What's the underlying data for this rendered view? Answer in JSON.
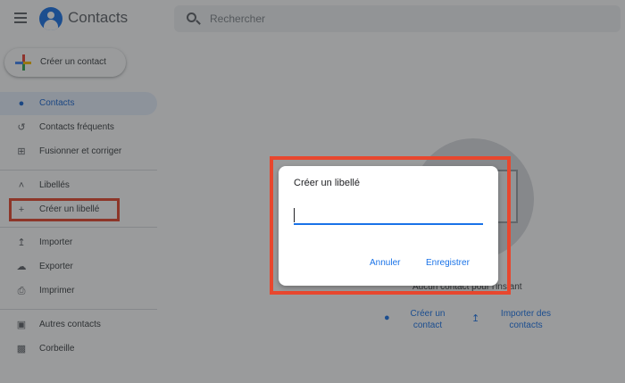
{
  "app": {
    "title": "Contacts",
    "search_placeholder": "Rechercher"
  },
  "sidebar": {
    "create_contact": "Créer un contact",
    "items": [
      {
        "label": "Contacts",
        "icon": "person-icon",
        "active": true
      },
      {
        "label": "Contacts fréquents",
        "icon": "history-icon"
      },
      {
        "label": "Fusionner et corriger",
        "icon": "merge-icon"
      }
    ],
    "labels_header": "Libellés",
    "create_label": "Créer un libellé",
    "tools": [
      {
        "label": "Importer",
        "icon": "upload-icon"
      },
      {
        "label": "Exporter",
        "icon": "cloud-upload-icon"
      },
      {
        "label": "Imprimer",
        "icon": "printer-icon"
      }
    ],
    "other": [
      {
        "label": "Autres contacts",
        "icon": "contacts-book-icon"
      },
      {
        "label": "Corbeille",
        "icon": "trash-icon"
      }
    ]
  },
  "main": {
    "empty_text": "Aucun contact pour l'instant",
    "create_contact_action": [
      "Créer un",
      "contact"
    ],
    "import_action": [
      "Importer des",
      "contacts"
    ]
  },
  "dialog": {
    "title": "Créer un libellé",
    "input_value": "",
    "cancel": "Annuler",
    "save": "Enregistrer"
  },
  "colors": {
    "accent": "#1a73e8",
    "highlight": "#e8472e"
  }
}
